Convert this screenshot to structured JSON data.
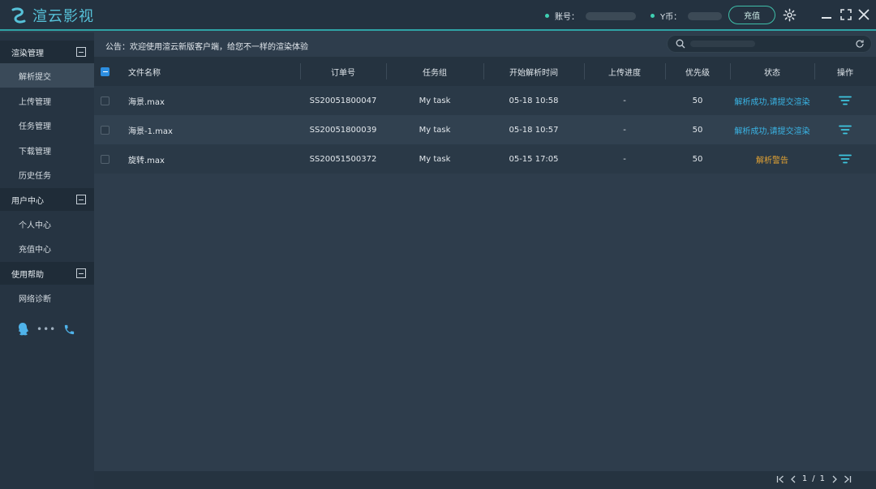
{
  "app": {
    "title": "渲云影视"
  },
  "header": {
    "account_label": "账号：",
    "ycoin_label": "Y币：",
    "recharge_label": "充值"
  },
  "sidebar": {
    "groups": [
      {
        "label": "渲染管理",
        "items": [
          "解析提交",
          "上传管理",
          "任务管理",
          "下载管理",
          "历史任务"
        ]
      },
      {
        "label": "用户中心",
        "items": [
          "个人中心",
          "充值中心"
        ]
      },
      {
        "label": "使用帮助",
        "items": [
          "网络诊断"
        ]
      }
    ],
    "active_item": "解析提交"
  },
  "notice": "公告：欢迎使用渲云新版客户端，给您不一样的渲染体验",
  "table": {
    "columns": [
      "文件名称",
      "订单号",
      "任务组",
      "开始解析时间",
      "上传进度",
      "优先级",
      "状态",
      "操作"
    ],
    "rows": [
      {
        "file": "海景.max",
        "order": "SS20051800047",
        "group": "My task",
        "time": "05-18 10:58",
        "progress": "-",
        "priority": "50",
        "status": "解析成功,请提交渲染",
        "status_type": "ok"
      },
      {
        "file": "海景-1.max",
        "order": "SS20051800039",
        "group": "My task",
        "time": "05-18 10:57",
        "progress": "-",
        "priority": "50",
        "status": "解析成功,请提交渲染",
        "status_type": "ok"
      },
      {
        "file": "旋转.max",
        "order": "SS20051500372",
        "group": "My task",
        "time": "05-15 17:05",
        "progress": "-",
        "priority": "50",
        "status": "解析警告",
        "status_type": "warn"
      }
    ]
  },
  "pagination": {
    "current": "1",
    "separator": "/",
    "total": "1"
  },
  "colors": {
    "accent": "#2fa3a6",
    "ok": "#3ab5e6",
    "warn": "#e2a233"
  },
  "icons": [
    "logo-icon",
    "settings-gear-icon",
    "minimize-icon",
    "maximize-icon",
    "close-icon",
    "search-icon",
    "refresh-icon",
    "qq-icon",
    "more-icon",
    "phone-icon",
    "filter-action-icon",
    "first-page-icon",
    "prev-page-icon",
    "next-page-icon",
    "last-page-icon"
  ]
}
